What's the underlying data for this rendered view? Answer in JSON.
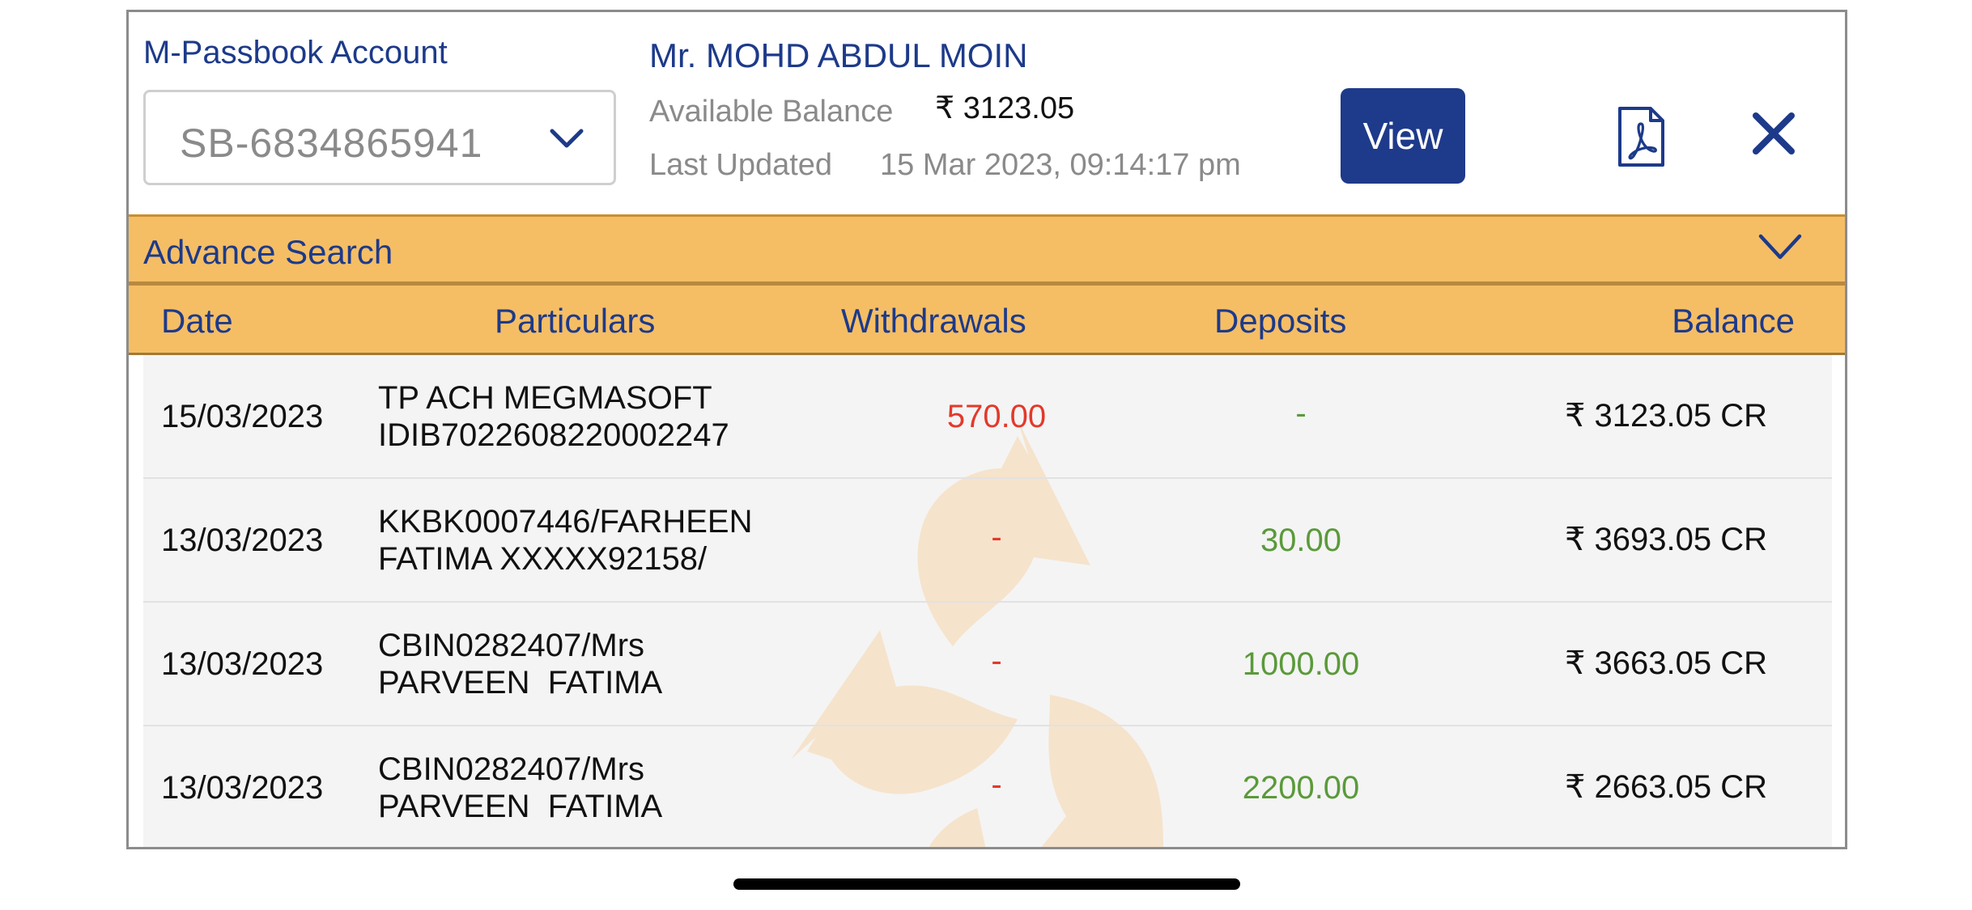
{
  "header": {
    "account_label": "M-Passbook Account",
    "account_selected": "SB-6834865941",
    "customer_name": "Mr. MOHD ABDUL MOIN",
    "available_balance_label": "Available Balance",
    "available_balance_value": "₹ 3123.05",
    "last_updated_label": "Last Updated",
    "last_updated_value": "15 Mar 2023, 09:14:17 pm",
    "view_label": "View",
    "pdf_icon": "pdf-icon",
    "close_icon": "close-icon"
  },
  "advance_search": {
    "label": "Advance Search"
  },
  "table": {
    "columns": [
      "Date",
      "Particulars",
      "Withdrawals",
      "Deposits",
      "Balance"
    ],
    "rows": [
      {
        "date": "15/03/2023",
        "particulars": "TP ACH MEGMASOFT\nIDIB7022608220002247",
        "withdrawal": "570.00",
        "deposit": "-",
        "balance": "₹ 3123.05 CR"
      },
      {
        "date": "13/03/2023",
        "particulars": "KKBK0007446/FARHEEN\nFATIMA XXXXX92158/",
        "withdrawal": "-",
        "deposit": "30.00",
        "balance": "₹ 3693.05 CR"
      },
      {
        "date": "13/03/2023",
        "particulars": "CBIN0282407/Mrs\nPARVEEN  FATIMA",
        "withdrawal": "-",
        "deposit": "1000.00",
        "balance": "₹ 3663.05 CR"
      },
      {
        "date": "13/03/2023",
        "particulars": "CBIN0282407/Mrs\nPARVEEN  FATIMA",
        "withdrawal": "-",
        "deposit": "2200.00",
        "balance": "₹ 2663.05 CR"
      }
    ]
  },
  "colors": {
    "brand_blue": "#1e3a8a",
    "header_orange": "#f5be65",
    "withdrawal_red": "#e3392b",
    "deposit_green": "#5a9a3a"
  }
}
